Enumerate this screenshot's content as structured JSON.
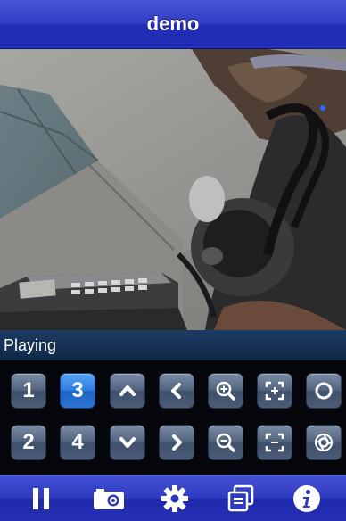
{
  "header": {
    "title": "demo"
  },
  "status": {
    "text": "Playing"
  },
  "controls": {
    "channels": [
      "1",
      "3",
      "2",
      "4"
    ],
    "active_channel": "3"
  },
  "icons": {
    "up": "arrow-up-icon",
    "down": "arrow-down-icon",
    "left": "arrow-left-icon",
    "right": "arrow-right-icon",
    "zoom_in": "zoom-in-icon",
    "zoom_out": "zoom-out-icon",
    "focus_near": "focus-expand-icon",
    "focus_far": "focus-shrink-icon",
    "iris_open": "iris-open-icon",
    "iris_close": "iris-close-icon",
    "pause": "pause-icon",
    "snapshot": "camera-icon",
    "settings": "gear-icon",
    "layout": "multi-window-icon",
    "info": "info-icon"
  },
  "colors": {
    "bar_blue": "#2f3cc4",
    "status_bg": "#1d3c63",
    "button_gray": "#52637e",
    "button_active": "#2e7ee0"
  }
}
